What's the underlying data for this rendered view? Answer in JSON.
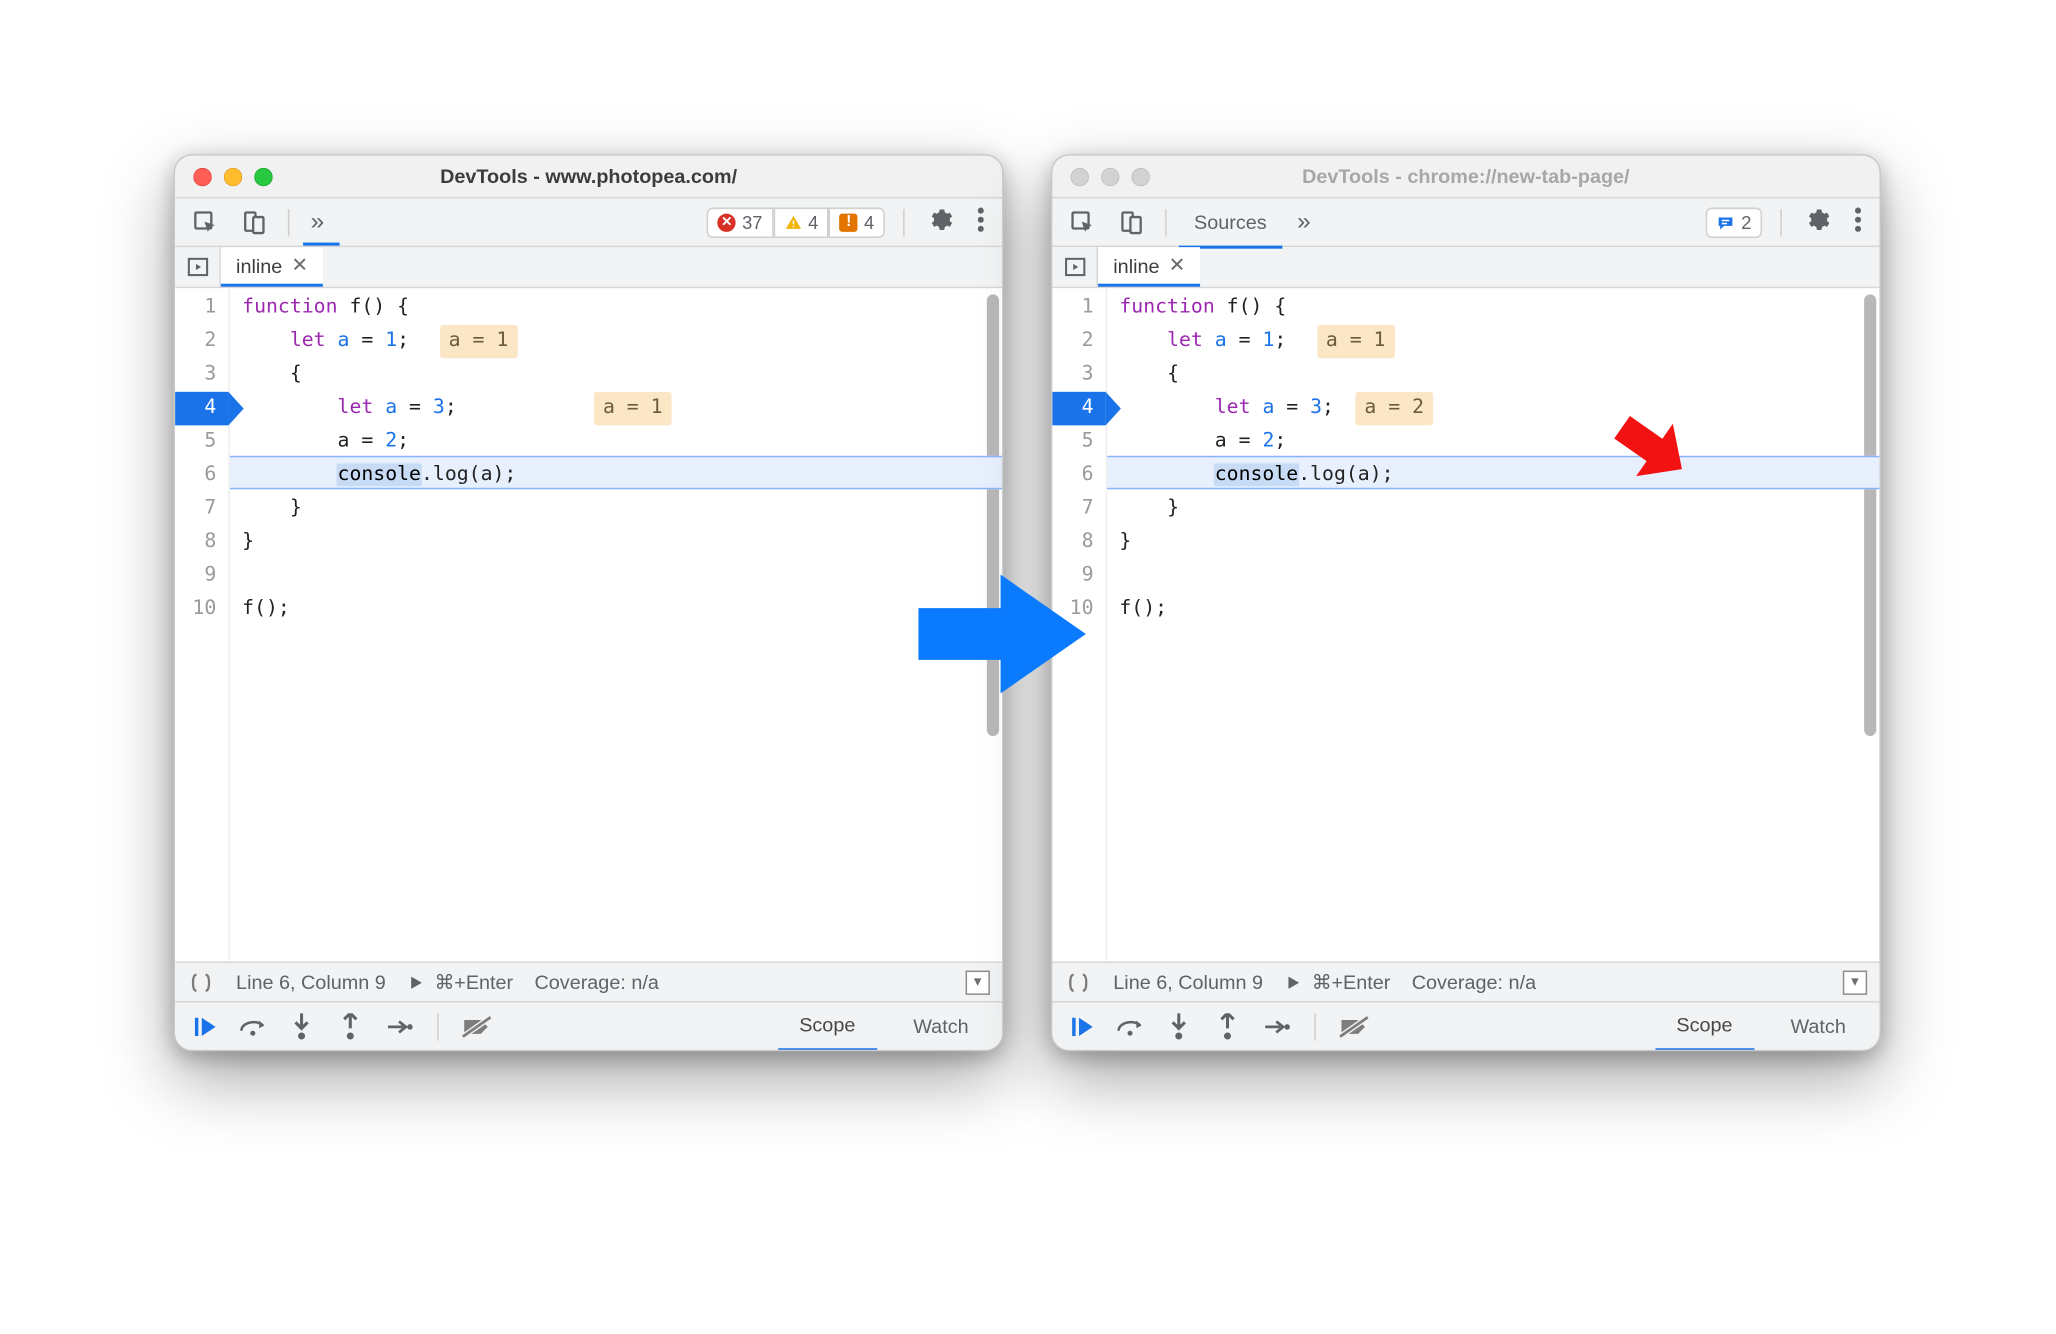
{
  "left": {
    "title": "DevTools - www.photopea.com/",
    "toolbar": {
      "errors": "37",
      "warnings": "4",
      "issues": "4"
    },
    "file_tab": "inline",
    "source_lines": [
      "1",
      "2",
      "3",
      "4",
      "5",
      "6",
      "7",
      "8",
      "9",
      "10"
    ],
    "current_line": "4",
    "inline_eval_line2": "a = 1",
    "inline_eval_line4": "a = 1",
    "code": {
      "kw_function": "function",
      "fn_name": "f",
      "paren_open": "() {",
      "kw_let": "let",
      "var_a": "a",
      "eq": " = ",
      "one": "1",
      "semi": ";",
      "brace_open": "{",
      "three": "3",
      "two": "2",
      "assign2": "a = ",
      "console": "console",
      "dot_log": ".log(a);",
      "brace_close": "}",
      "call": "f();"
    },
    "status": {
      "pos": "Line 6, Column 9",
      "run": "⌘+Enter",
      "coverage": "Coverage: n/a"
    },
    "tabs": {
      "scope": "Scope",
      "watch": "Watch"
    }
  },
  "right": {
    "title": "DevTools - chrome://new-tab-page/",
    "tab_sources": "Sources",
    "toolbar": {
      "chat": "2"
    },
    "file_tab": "inline",
    "source_lines": [
      "1",
      "2",
      "3",
      "4",
      "5",
      "6",
      "7",
      "8",
      "9",
      "10"
    ],
    "current_line": "4",
    "inline_eval_line2": "a = 1",
    "inline_eval_line4": "a = 2",
    "status": {
      "pos": "Line 6, Column 9",
      "run": "⌘+Enter",
      "coverage": "Coverage: n/a"
    },
    "tabs": {
      "scope": "Scope",
      "watch": "Watch"
    }
  }
}
